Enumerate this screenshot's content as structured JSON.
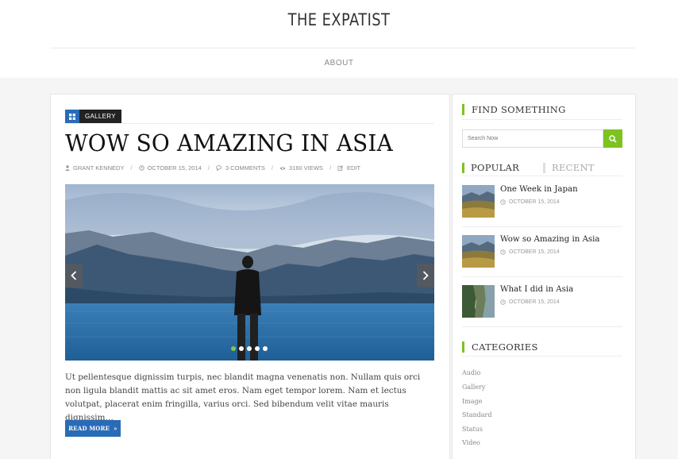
{
  "site": {
    "title": "THE EXPATIST",
    "nav": {
      "about": "ABOUT"
    }
  },
  "post": {
    "category": "GALLERY",
    "title": "WOW SO AMAZING IN ASIA",
    "meta": {
      "author": "GRANT KENNEDY",
      "date": "OCTOBER 15, 2014",
      "comments": "3 COMMENTS",
      "views": "3160 VIEWS",
      "edit": "EDIT"
    },
    "slider": {
      "dots": 5,
      "active_dot": 0
    },
    "excerpt": "Ut pellentesque dignissim turpis, nec blandit magna venenatis non. Nullam quis orci non ligula blandit mattis ac sit amet eros. Nam eget tempor lorem. Nam et lectus volutpat, placerat enim fringilla, varius orci. Sed bibendum velit vitae mauris dignissim…",
    "read_more": "READ MORE"
  },
  "sidebar": {
    "search": {
      "title": "FIND SOMETHING",
      "placeholder": "Search Now"
    },
    "tabs": {
      "popular": "POPULAR",
      "recent": "RECENT"
    },
    "popular": [
      {
        "title": "One Week in Japan",
        "date": "OCTOBER 15, 2014",
        "thumb": "valley"
      },
      {
        "title": "Wow so Amazing in Asia",
        "date": "OCTOBER 15, 2014",
        "thumb": "valley"
      },
      {
        "title": "What I did in Asia",
        "date": "OCTOBER 15, 2014",
        "thumb": "cliff"
      }
    ],
    "categories": {
      "title": "CATEGORIES",
      "items": [
        "Audio",
        "Gallery",
        "Image",
        "Standard",
        "Status",
        "Video"
      ]
    }
  },
  "colors": {
    "accent_green": "#7cc31f",
    "accent_blue": "#2a6bb7",
    "badge_dark": "#222222"
  }
}
